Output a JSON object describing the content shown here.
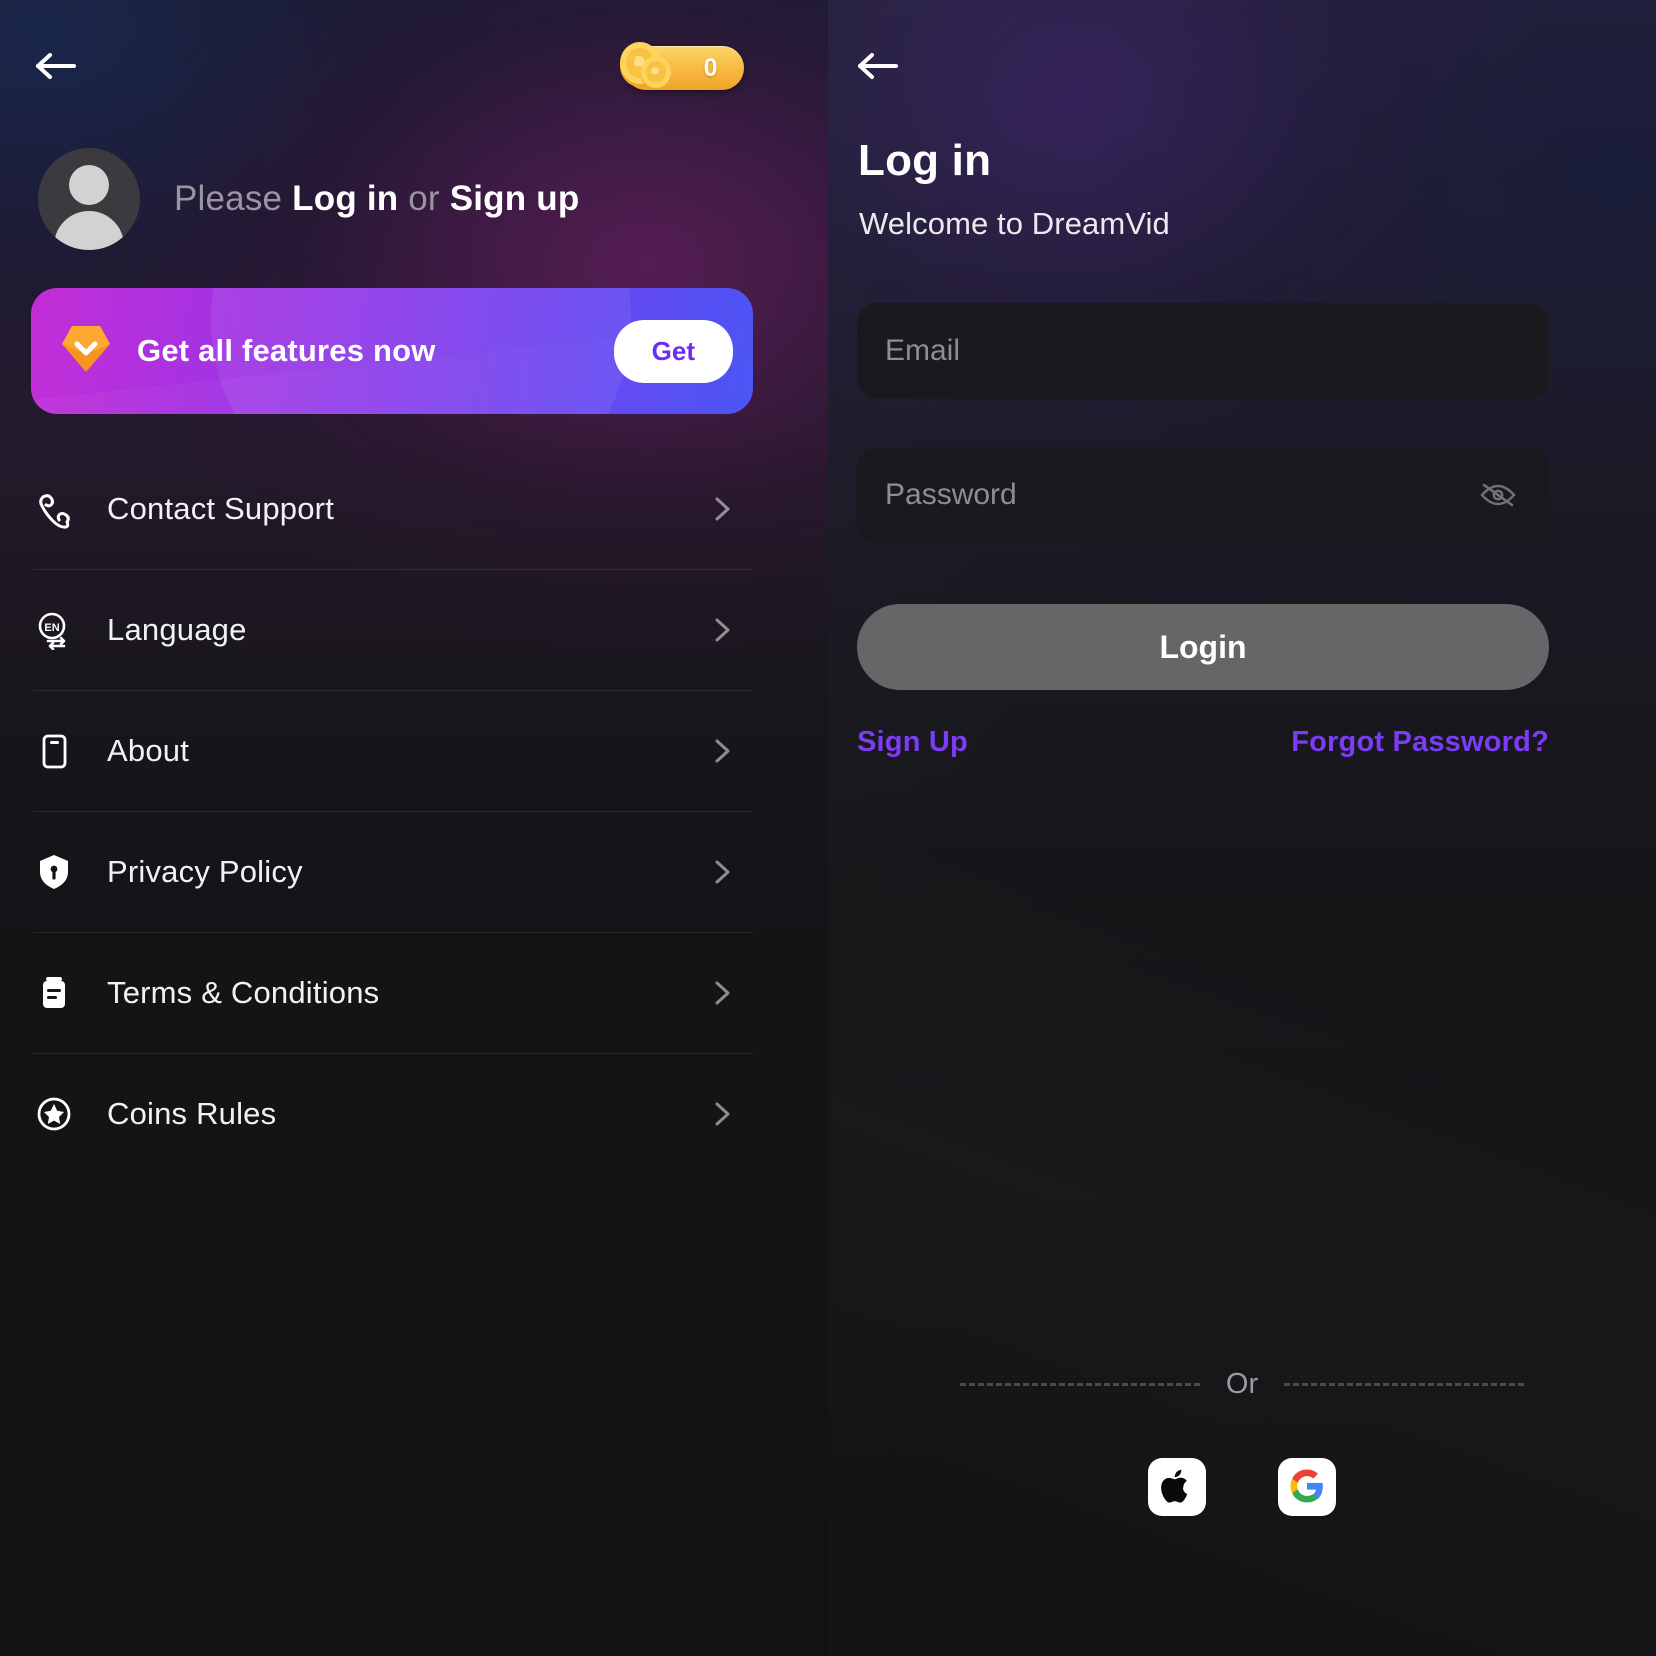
{
  "left": {
    "back_icon": "back-arrow-icon",
    "coins": {
      "icon": "coins-icon",
      "count": "0"
    },
    "profile": {
      "avatar_icon": "default-avatar-icon",
      "prefix": "Please ",
      "login_label": "Log in",
      "separator": " or ",
      "signup_label": "Sign up"
    },
    "promo": {
      "icon": "gem-icon",
      "text": "Get all features now",
      "button_label": "Get"
    },
    "menu": [
      {
        "icon": "phone-support-icon",
        "label": "Contact Support",
        "chevron": "chevron-right-icon"
      },
      {
        "icon": "language-en-icon",
        "label": "Language",
        "chevron": "chevron-right-icon"
      },
      {
        "icon": "device-about-icon",
        "label": "About",
        "chevron": "chevron-right-icon"
      },
      {
        "icon": "shield-privacy-icon",
        "label": "Privacy Policy",
        "chevron": "chevron-right-icon"
      },
      {
        "icon": "document-terms-icon",
        "label": "Terms & Conditions",
        "chevron": "chevron-right-icon"
      },
      {
        "icon": "star-coins-icon",
        "label": "Coins Rules",
        "chevron": "chevron-right-icon"
      }
    ]
  },
  "right": {
    "back_icon": "back-arrow-icon",
    "title": "Log in",
    "subtitle": "Welcome to DreamVid",
    "email": {
      "placeholder": "Email",
      "value": ""
    },
    "password": {
      "placeholder": "Password",
      "value": "",
      "toggle_icon": "eye-off-icon"
    },
    "login_button": "Login",
    "sign_up_link": "Sign Up",
    "forgot_password_link": "Forgot Password?",
    "or_text": "Or",
    "social": [
      {
        "name": "apple-login-button",
        "icon": "apple-icon"
      },
      {
        "name": "google-login-button",
        "icon": "google-icon"
      }
    ]
  },
  "colors": {
    "accent_purple": "#7c3cf5",
    "promo_gradient_start": "#c32ed6",
    "promo_gradient_end": "#4a55f5",
    "coin_gold": "#f7b83f",
    "login_button": "#666668"
  }
}
